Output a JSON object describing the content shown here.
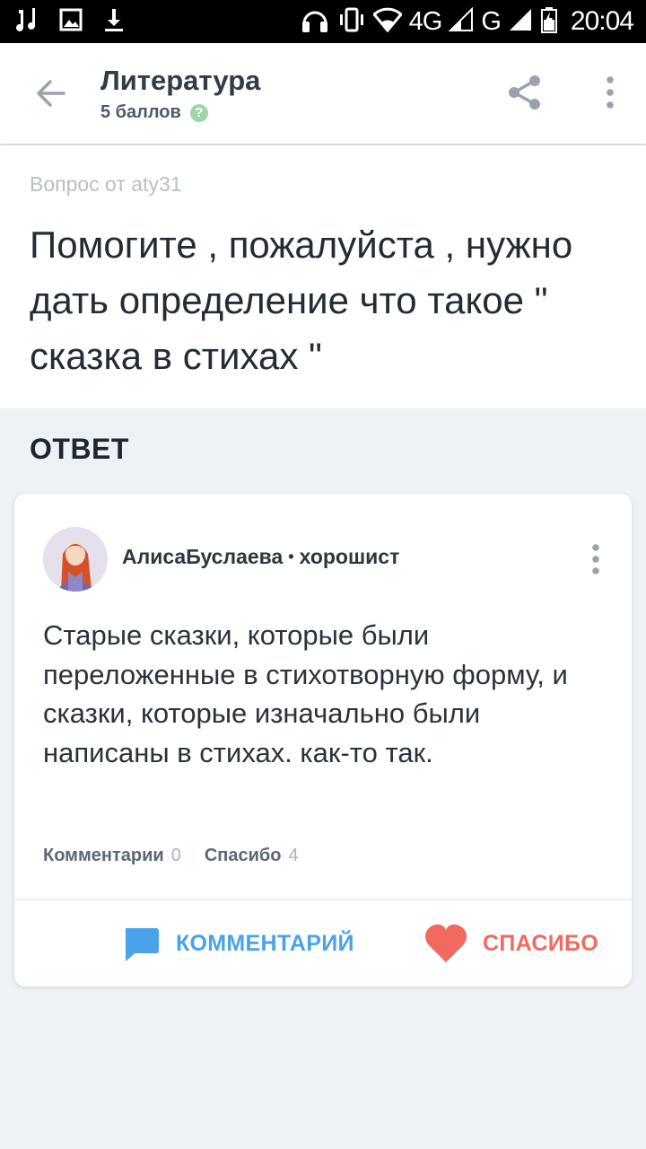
{
  "status_bar": {
    "network_4g": "4G",
    "network_g": "G",
    "time": "20:04"
  },
  "header": {
    "subject": "Литература",
    "points": "5 баллов",
    "help_symbol": "?"
  },
  "question": {
    "asked_by": "Вопрос от aty31",
    "text": "Помогите , пожалуйста , нужно дать определение что такое \" сказка в стихах \""
  },
  "answer_section": {
    "heading": "ОТВЕТ",
    "author_name": "АлисаБуслаева",
    "author_separator": "•",
    "author_rank": "хорошист",
    "text": "Старые сказки, которые были переложенные в стихотворную форму, и сказки, которые изначально были написаны в стихах. как-то так.",
    "comments_label": "Комментарии",
    "comments_count": "0",
    "thanks_label": "Спасибо",
    "thanks_count": "4",
    "comment_button": "КОММЕНТАРИЙ",
    "thanks_button": "СПАСИБО"
  },
  "colors": {
    "accent_blue": "#4aa3e8",
    "accent_red": "#f26a5e",
    "background": "#eef1f5"
  },
  "icons": [
    "music-icon",
    "image-icon",
    "download-icon",
    "headset-icon",
    "vibrate-icon",
    "wifi-icon",
    "signal-icon",
    "battery-icon",
    "back-arrow-icon",
    "share-icon",
    "more-vertical-icon",
    "comment-bubble-icon",
    "heart-icon"
  ]
}
